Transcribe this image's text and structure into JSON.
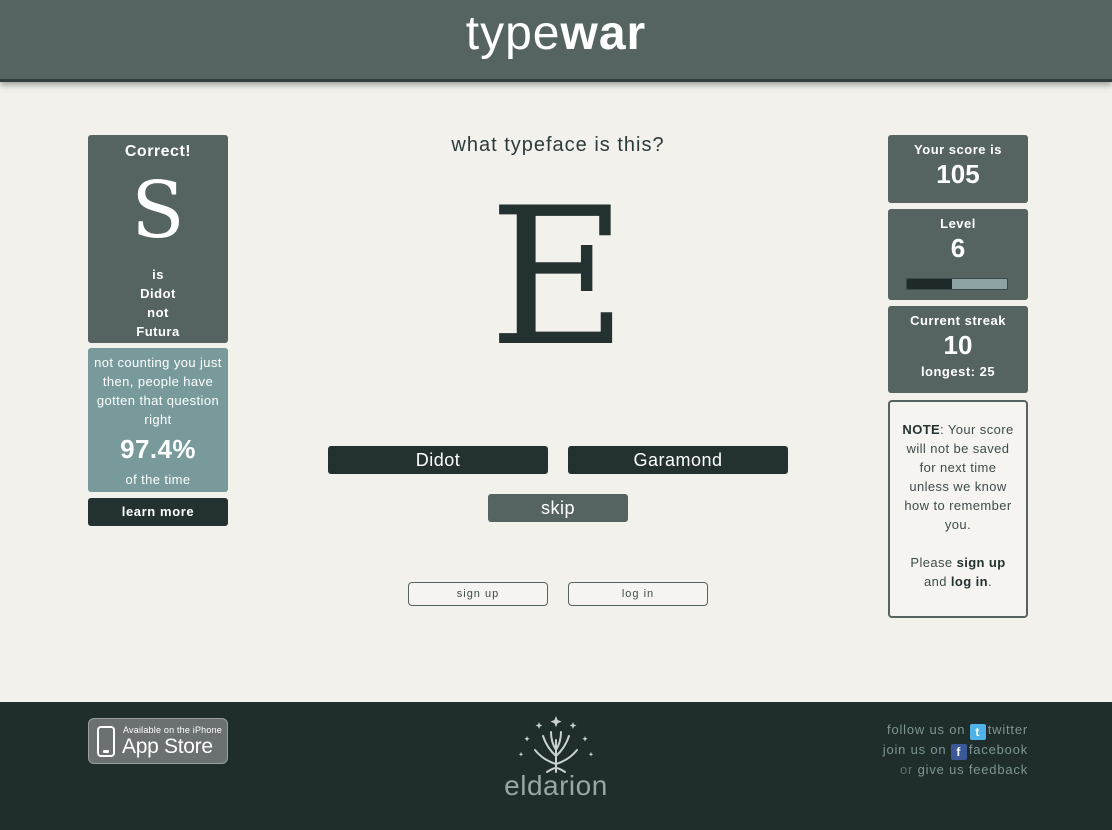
{
  "header": {
    "logo_part1": "type",
    "logo_part2": "war"
  },
  "result": {
    "title": "Correct!",
    "glyph": "S",
    "line_is": "is",
    "correct_font": "Didot",
    "line_not": "not",
    "wrong_font": "Futura"
  },
  "stats": {
    "text1": "not counting you just then, people have gotten that question right",
    "percent": "97.4%",
    "text2": "of the time"
  },
  "learn_more_label": "learn more",
  "question": {
    "prompt": "what typeface is this?",
    "glyph": "E",
    "option_left": "Didot",
    "option_right": "Garamond",
    "skip_label": "skip"
  },
  "auth": {
    "signup_label": "sign up",
    "login_label": "log in"
  },
  "score": {
    "label": "Your score is",
    "value": "105"
  },
  "level": {
    "label": "Level",
    "value": "6",
    "progress": 0.45
  },
  "streak": {
    "label": "Current streak",
    "value": "10",
    "longest": "longest: 25"
  },
  "note": {
    "bold": "NOTE",
    "text": ": Your score will not be saved for next time unless we know how to remember you.",
    "please": "Please",
    "signup_link": "sign up",
    "and": "and",
    "login_link": "log in",
    "period": "."
  },
  "footer": {
    "appstore_small": "Available on the iPhone",
    "appstore_big": "App Store",
    "brand": "eldarion",
    "follow_prefix": "follow us on",
    "twitter_link": "twitter",
    "join_prefix": "join us on",
    "facebook_link": "facebook",
    "or": "or",
    "feedback_link": "give us feedback"
  },
  "colors": {
    "header_bg": "#566461",
    "panel_bg": "#566461",
    "stats_bg": "#789a9b",
    "dark_btn": "#233131",
    "footer_bg": "#1f2d2c",
    "page_bg": "#f2f1ec"
  },
  "icons": [
    "twitter-icon",
    "facebook-icon",
    "iphone-icon",
    "eldarion-tree-logo"
  ]
}
